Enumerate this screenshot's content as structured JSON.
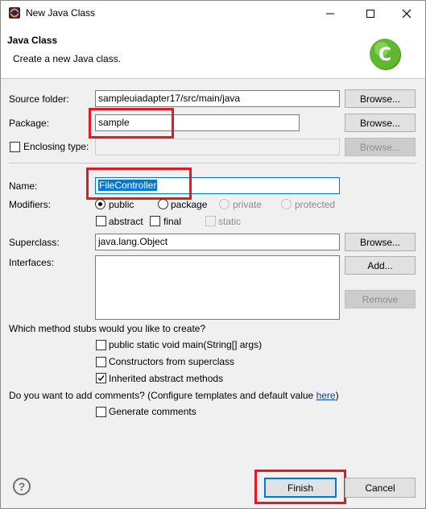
{
  "window": {
    "title": "New Java Class",
    "icon": "eclipse-window-icon"
  },
  "header": {
    "title": "Java Class",
    "subtitle": "Create a new Java class.",
    "logo": "java-class-wizard-logo"
  },
  "source_folder": {
    "label": "Source folder:",
    "value": "sampleuiadapter17/src/main/java",
    "button": "Browse..."
  },
  "package": {
    "label": "Package:",
    "value": "sample",
    "button": "Browse..."
  },
  "enclosing_type": {
    "label": "Enclosing type:",
    "value": "",
    "button": "Browse...",
    "checked": false
  },
  "name": {
    "label": "Name:",
    "value": "FileController"
  },
  "modifiers": {
    "label": "Modifiers:",
    "visibility": [
      {
        "label": "public",
        "checked": true,
        "enabled": true
      },
      {
        "label": "package",
        "checked": false,
        "enabled": true
      },
      {
        "label": "private",
        "checked": false,
        "enabled": false
      },
      {
        "label": "protected",
        "checked": false,
        "enabled": false
      }
    ],
    "flags": [
      {
        "label": "abstract",
        "checked": false,
        "enabled": true
      },
      {
        "label": "final",
        "checked": false,
        "enabled": true
      },
      {
        "label": "static",
        "checked": false,
        "enabled": false
      }
    ]
  },
  "superclass": {
    "label": "Superclass:",
    "value": "java.lang.Object",
    "button": "Browse..."
  },
  "interfaces": {
    "label": "Interfaces:",
    "add_button": "Add...",
    "remove_button": "Remove"
  },
  "stubs": {
    "question": "Which method stubs would you like to create?",
    "options": [
      {
        "label": "public static void main(String[] args)",
        "checked": false
      },
      {
        "label": "Constructors from superclass",
        "checked": false
      },
      {
        "label": "Inherited abstract methods",
        "checked": true
      }
    ]
  },
  "comments": {
    "question": "Do you want to add comments? (Configure templates and default value ",
    "link": "here",
    "question_end": ")",
    "option": {
      "label": "Generate comments",
      "checked": false
    }
  },
  "footer": {
    "help": "?",
    "finish": "Finish",
    "cancel": "Cancel"
  },
  "colors": {
    "highlight": "#e5191f",
    "selection": "#0078d7",
    "logo_green": "#5fb82f"
  }
}
